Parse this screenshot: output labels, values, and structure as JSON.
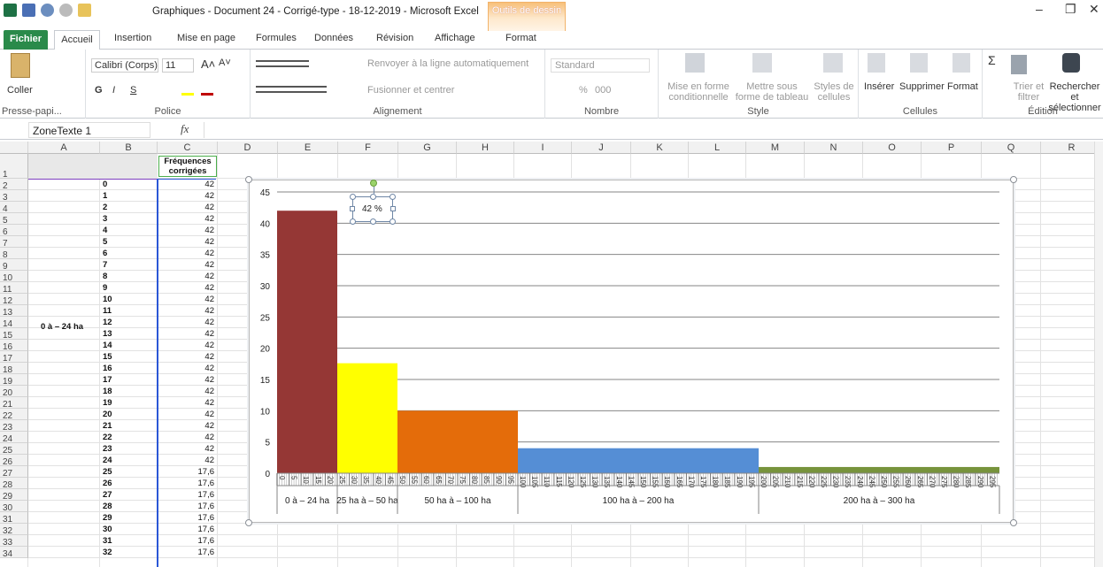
{
  "window": {
    "title": "Graphiques - Document 24 - Corrigé-type - 18-12-2019 - Microsoft Excel",
    "context_tab": "Outils de dessin",
    "min": "–",
    "max": "❐",
    "close": "✕"
  },
  "tabs": [
    "Fichier",
    "Accueil",
    "Insertion",
    "Mise en page",
    "Formules",
    "Données",
    "Révision",
    "Affichage",
    "Format"
  ],
  "ribbon": {
    "clipboard": {
      "paste": "Coller",
      "label": "Presse-papi..."
    },
    "font": {
      "name": "Calibri (Corps)",
      "size": "11",
      "bold": "G",
      "italic": "I",
      "underline": "S",
      "grow": "A˄",
      "shrink": "A˅",
      "label": "Police"
    },
    "alignment": {
      "wrap": "Renvoyer à la ligne automatiquement",
      "merge": "Fusionner et centrer",
      "label": "Alignement"
    },
    "number": {
      "format": "Standard",
      "percent": "%",
      "thousands": "000",
      "label": "Nombre"
    },
    "style": {
      "cond": "Mise en forme conditionnelle",
      "table": "Mettre sous forme de tableau",
      "styles": "Styles de cellules",
      "label": "Style"
    },
    "cells": {
      "insert": "Insérer",
      "delete": "Supprimer",
      "format": "Format",
      "label": "Cellules"
    },
    "editing": {
      "sort": "Trier et filtrer",
      "find": "Rechercher et sélectionner",
      "label": "Édition"
    }
  },
  "formula_bar": {
    "name_box": "ZoneTexte 1",
    "fx": "fx",
    "content": ""
  },
  "columns": [
    "A",
    "B",
    "C",
    "D",
    "E",
    "F",
    "G",
    "H",
    "I",
    "J",
    "K",
    "L",
    "M",
    "N",
    "O",
    "P",
    "Q",
    "R"
  ],
  "header_c": "Fréquences corrigées",
  "a_label": "0 à – 24 ha",
  "rows": [
    {
      "r": "1",
      "b": "",
      "c": ""
    },
    {
      "r": "2",
      "b": "0",
      "c": "42"
    },
    {
      "r": "3",
      "b": "1",
      "c": "42"
    },
    {
      "r": "4",
      "b": "2",
      "c": "42"
    },
    {
      "r": "5",
      "b": "3",
      "c": "42"
    },
    {
      "r": "6",
      "b": "4",
      "c": "42"
    },
    {
      "r": "7",
      "b": "5",
      "c": "42"
    },
    {
      "r": "8",
      "b": "6",
      "c": "42"
    },
    {
      "r": "9",
      "b": "7",
      "c": "42"
    },
    {
      "r": "10",
      "b": "8",
      "c": "42"
    },
    {
      "r": "11",
      "b": "9",
      "c": "42"
    },
    {
      "r": "12",
      "b": "10",
      "c": "42"
    },
    {
      "r": "13",
      "b": "11",
      "c": "42"
    },
    {
      "r": "14",
      "b": "12",
      "c": "42"
    },
    {
      "r": "15",
      "b": "13",
      "c": "42"
    },
    {
      "r": "16",
      "b": "14",
      "c": "42"
    },
    {
      "r": "17",
      "b": "15",
      "c": "42"
    },
    {
      "r": "18",
      "b": "16",
      "c": "42"
    },
    {
      "r": "19",
      "b": "17",
      "c": "42"
    },
    {
      "r": "20",
      "b": "18",
      "c": "42"
    },
    {
      "r": "21",
      "b": "19",
      "c": "42"
    },
    {
      "r": "22",
      "b": "20",
      "c": "42"
    },
    {
      "r": "23",
      "b": "21",
      "c": "42"
    },
    {
      "r": "24",
      "b": "22",
      "c": "42"
    },
    {
      "r": "25",
      "b": "23",
      "c": "42"
    },
    {
      "r": "26",
      "b": "24",
      "c": "42"
    },
    {
      "r": "27",
      "b": "25",
      "c": "17,6"
    },
    {
      "r": "28",
      "b": "26",
      "c": "17,6"
    },
    {
      "r": "29",
      "b": "27",
      "c": "17,6"
    },
    {
      "r": "30",
      "b": "28",
      "c": "17,6"
    },
    {
      "r": "31",
      "b": "29",
      "c": "17,6"
    },
    {
      "r": "32",
      "b": "30",
      "c": "17,6"
    },
    {
      "r": "33",
      "b": "31",
      "c": "17,6"
    },
    {
      "r": "34",
      "b": "32",
      "c": "17,6"
    }
  ],
  "chart_data": {
    "type": "bar",
    "title": "",
    "ylim": [
      0,
      45
    ],
    "yticks": [
      0,
      5,
      10,
      15,
      20,
      25,
      30,
      35,
      40,
      45
    ],
    "bars": [
      {
        "label": "0 à – 24 ha",
        "from": 0,
        "to": 25,
        "value": 42,
        "color": "#953735"
      },
      {
        "label": "25 ha à – 50 ha",
        "from": 25,
        "to": 50,
        "value": 17.6,
        "color": "#ffff00"
      },
      {
        "label": "50 ha à – 100 ha",
        "from": 50,
        "to": 100,
        "value": 10,
        "color": "#e46c0a"
      },
      {
        "label": "100 ha à – 200 ha",
        "from": 100,
        "to": 200,
        "value": 4,
        "color": "#558ed5"
      },
      {
        "label": "200 ha à – 300 ha",
        "from": 200,
        "to": 300,
        "value": 1,
        "color": "#77933c"
      }
    ],
    "x_tick_step": 5,
    "annotation": "42 %"
  }
}
